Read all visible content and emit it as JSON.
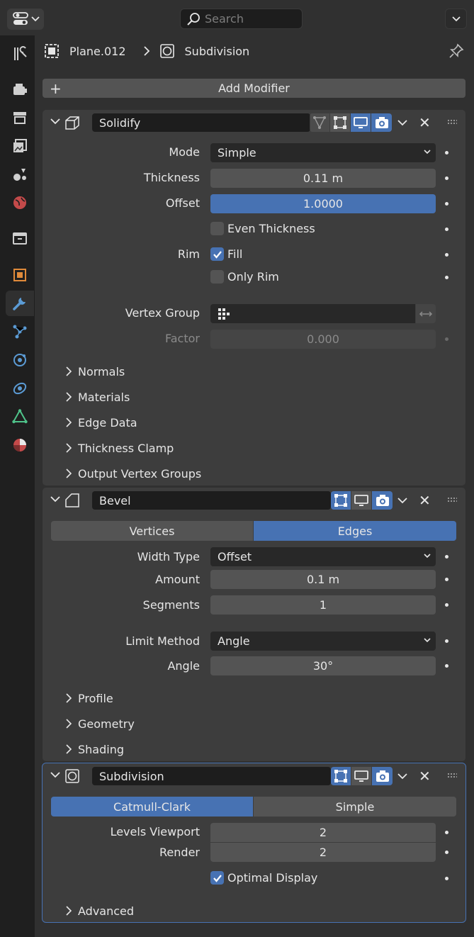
{
  "header": {
    "search_placeholder": "Search"
  },
  "breadcrumb": {
    "object_name": "Plane.012",
    "separator": ">",
    "modifier_name": "Subdivision"
  },
  "add_modifier_label": "Add Modifier",
  "solidify": {
    "name": "Solidify",
    "mode_label": "Mode",
    "mode_value": "Simple",
    "thickness_label": "Thickness",
    "thickness_value": "0.11 m",
    "offset_label": "Offset",
    "offset_value": "1.0000",
    "even_thickness_label": "Even Thickness",
    "even_thickness_checked": false,
    "rim_label": "Rim",
    "fill_label": "Fill",
    "fill_checked": true,
    "only_rim_label": "Only Rim",
    "only_rim_checked": false,
    "vertex_group_label": "Vertex Group",
    "vertex_group_value": "",
    "factor_label": "Factor",
    "factor_value": "0.000",
    "subpanels": [
      "Normals",
      "Materials",
      "Edge Data",
      "Thickness Clamp",
      "Output Vertex Groups"
    ]
  },
  "bevel": {
    "name": "Bevel",
    "affect_options": [
      "Vertices",
      "Edges"
    ],
    "affect_selected": "Edges",
    "width_type_label": "Width Type",
    "width_type_value": "Offset",
    "amount_label": "Amount",
    "amount_value": "0.1 m",
    "segments_label": "Segments",
    "segments_value": "1",
    "limit_method_label": "Limit Method",
    "limit_method_value": "Angle",
    "angle_label": "Angle",
    "angle_value": "30°",
    "subpanels": [
      "Profile",
      "Geometry",
      "Shading"
    ]
  },
  "subdivision": {
    "name": "Subdivision",
    "algorithm_options": [
      "Catmull-Clark",
      "Simple"
    ],
    "algorithm_selected": "Catmull-Clark",
    "levels_viewport_label": "Levels Viewport",
    "levels_viewport_value": "2",
    "render_label": "Render",
    "render_value": "2",
    "optimal_display_label": "Optimal Display",
    "optimal_display_checked": true,
    "subpanels": [
      "Advanced"
    ]
  },
  "colors": {
    "accent": "#4772b3",
    "panel_bg": "#3d3d3d",
    "editor_bg": "#303030",
    "field_bg": "#545454"
  },
  "sidebar_tabs": [
    "tool-icon",
    "render-icon",
    "output-icon",
    "view-layer-icon",
    "scene-icon",
    "world-icon",
    "collection-icon",
    "object-icon",
    "modifier-icon",
    "particles-icon",
    "physics-icon",
    "constraints-icon",
    "data-icon",
    "material-icon"
  ]
}
